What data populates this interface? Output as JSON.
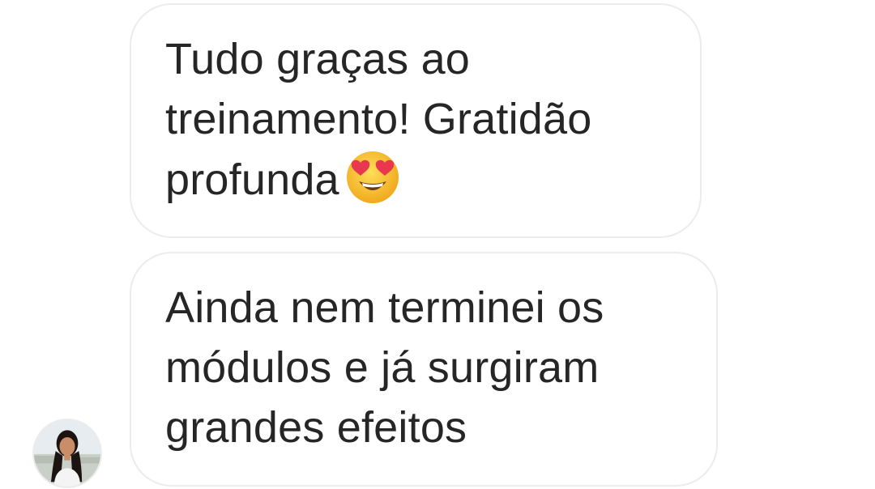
{
  "messages": [
    {
      "lines": [
        "Tudo graças ao",
        "treinamento! Gratidão",
        "profunda"
      ],
      "emoji": "heart-eyes-emoji"
    },
    {
      "lines": [
        "Ainda nem terminei os",
        "módulos e já surgiram",
        "grandes efeitos"
      ]
    }
  ],
  "avatar": {
    "icon": "profile-photo-avatar"
  },
  "colors": {
    "background": "#ffffff",
    "bubble_border": "#ececec",
    "text": "#262626",
    "emoji_face": "#f7c23a",
    "emoji_heart": "#e8384f"
  }
}
